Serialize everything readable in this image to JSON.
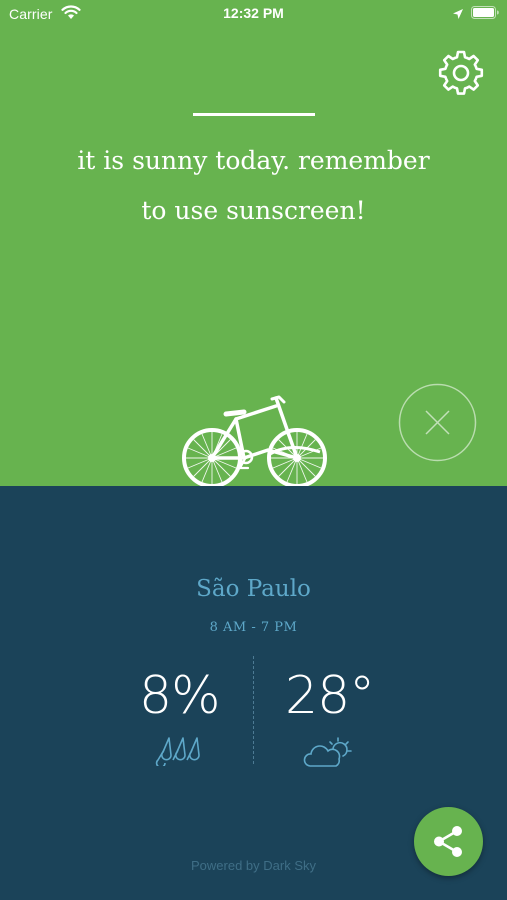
{
  "status_bar": {
    "carrier": "Carrier",
    "time": "12:32 PM"
  },
  "message": {
    "line1": "it is sunny today. remember",
    "line2": "to use sunscreen!"
  },
  "weather": {
    "city": "São Paulo",
    "hours": "8 AM - 7 PM",
    "rain_chance": "8%",
    "temperature": "28°"
  },
  "footer": {
    "powered_by": "Powered by Dark Sky"
  },
  "colors": {
    "top_background": "#67b34f",
    "bottom_background": "#1b4359",
    "accent_text": "#5ea8c9"
  },
  "icons": {
    "settings": "gear-icon",
    "dismiss": "close-icon",
    "illustration": "bicycle-icon",
    "rain": "rain-drops-icon",
    "weather": "partly-cloudy-icon",
    "share": "share-icon"
  }
}
